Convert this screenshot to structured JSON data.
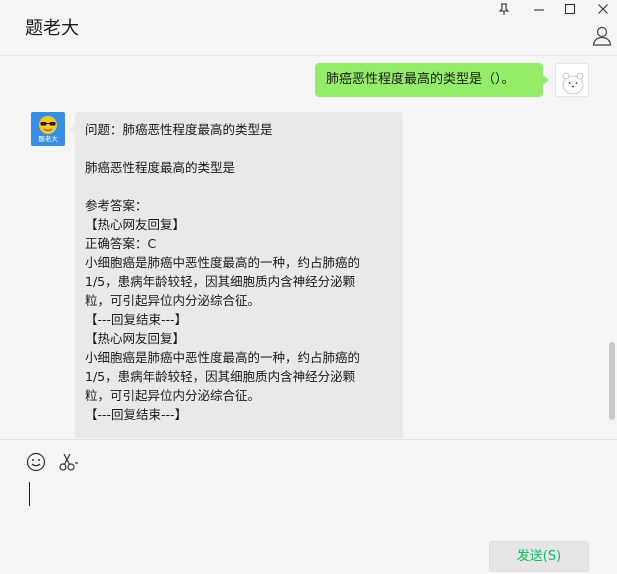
{
  "window": {
    "title": "题老大"
  },
  "chat": {
    "user_message": "肺癌恶性程度最高的类型是（）。",
    "bot_avatar_text": "题老大",
    "bot_lines": [
      "问题：肺癌恶性程度最高的类型是",
      "",
      "肺癌恶性程度最高的类型是",
      "",
      "参考答案：",
      "【热心网友回复】",
      "正确答案：C",
      "小细胞癌是肺癌中恶性度最高的一种，约占肺癌的",
      "1/5，患病年龄较轻，因其细胞质内含神经分泌颗",
      "粒，可引起异位内分泌综合征。",
      "【---回复结束---】",
      "【热心网友回复】",
      "小细胞癌是肺癌中恶性度最高的一种，约占肺癌的",
      "1/5，患病年龄较轻，因其细胞质内含神经分泌颗",
      "粒，可引起异位内分泌综合征。",
      "【---回复结束---】"
    ]
  },
  "input": {
    "value": "",
    "send_label": "发送(S)"
  },
  "icons": {
    "pin": "pin-icon",
    "minimize": "minimize-icon",
    "maximize": "maximize-icon",
    "close": "close-icon",
    "profile": "person-icon",
    "emoji": "emoji-icon",
    "screenshot": "scissors-icon"
  },
  "colors": {
    "user_bubble": "#95ec69",
    "bot_bubble": "#e9e9e9",
    "send_text": "#07c160",
    "background": "#f5f5f5"
  }
}
